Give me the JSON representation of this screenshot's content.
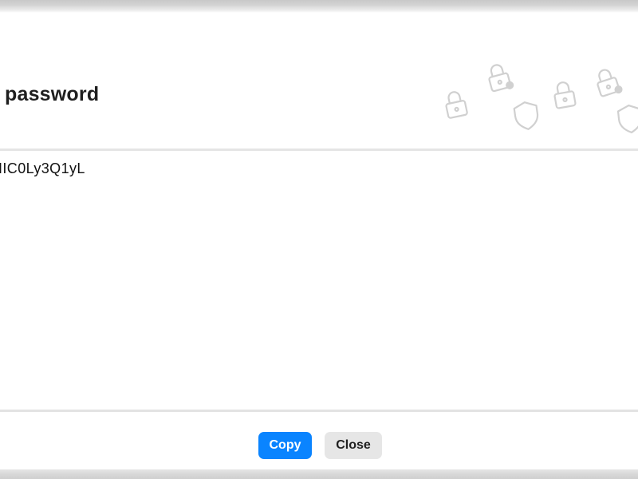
{
  "dialog": {
    "title": "password",
    "password_value": "IIC0Ly3Q1yL"
  },
  "buttons": {
    "copy_label": "Copy",
    "close_label": "Close"
  },
  "icons": {
    "decor": [
      "lock-icon",
      "lock-icon",
      "shield-icon",
      "lock-icon",
      "lock-icon",
      "shield-icon"
    ]
  },
  "colors": {
    "accent": "#0a84ff",
    "secondary_button": "#e6e6e6",
    "title_text": "#1f1f1f",
    "decor_stroke": "#d0d0d0"
  }
}
